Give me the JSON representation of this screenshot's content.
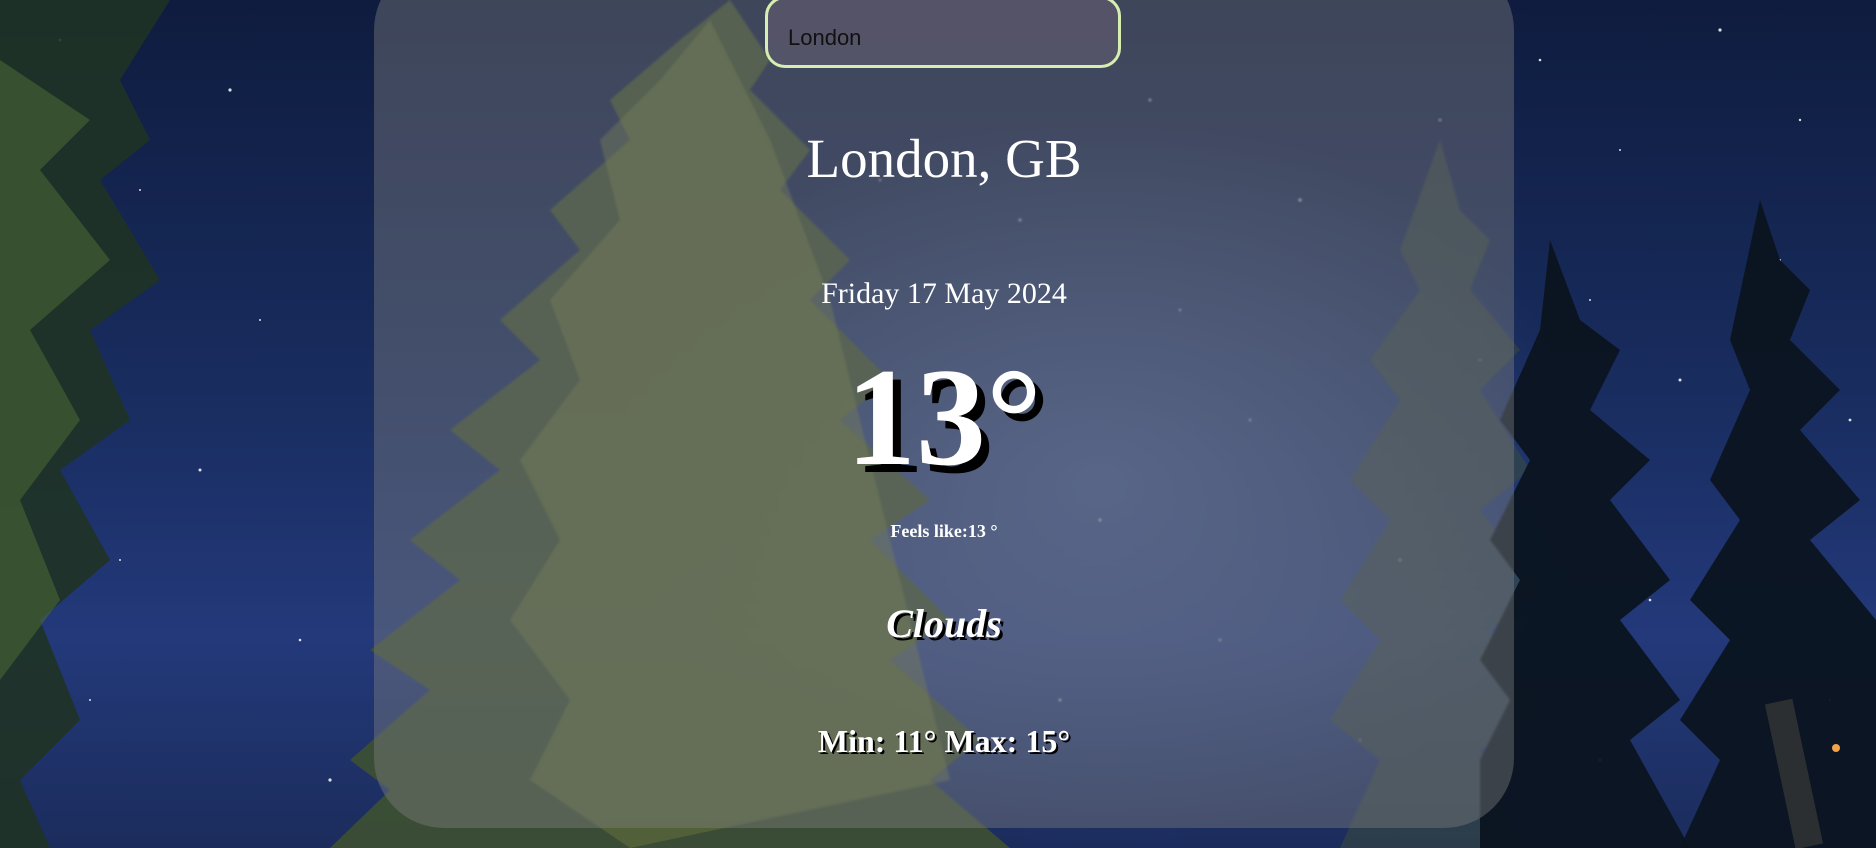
{
  "search": {
    "value": "London",
    "placeholder": ""
  },
  "weather": {
    "location": "London, GB",
    "date": "Friday 17 May 2024",
    "temperature": "13°",
    "feels_like": "Feels like:13 °",
    "condition": "Clouds",
    "min_max": "Min: 11° Max: 15°"
  },
  "colors": {
    "sky": "#182c5e",
    "card": "#808080",
    "search_border": "#d6efb1",
    "text": "#ffffff"
  },
  "icons": {
    "background": "night-sky-trees-image"
  }
}
